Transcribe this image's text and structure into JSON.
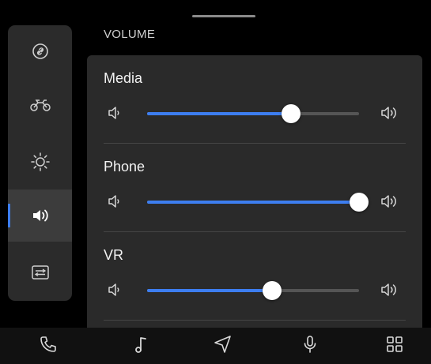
{
  "header": {
    "section_title": "VOLUME"
  },
  "sidebar": {
    "items": [
      {
        "icon": "link-icon",
        "active": false
      },
      {
        "icon": "motorcycle-icon",
        "active": false
      },
      {
        "icon": "brightness-icon",
        "active": false
      },
      {
        "icon": "volume-icon",
        "active": true
      },
      {
        "icon": "keyboard-icon",
        "active": false
      }
    ]
  },
  "volume": {
    "rows": [
      {
        "label": "Media",
        "level": 0.68
      },
      {
        "label": "Phone",
        "level": 1.0
      },
      {
        "label": "VR",
        "level": 0.59
      }
    ]
  },
  "bottom_nav": {
    "items": [
      "phone-icon",
      "music-icon",
      "navigation-icon",
      "microphone-icon",
      "apps-grid-icon"
    ]
  },
  "colors": {
    "accent": "#3d7ef0",
    "background": "#000000",
    "panel": "#2a2a2a",
    "sidebar": "#2b2b2b"
  }
}
